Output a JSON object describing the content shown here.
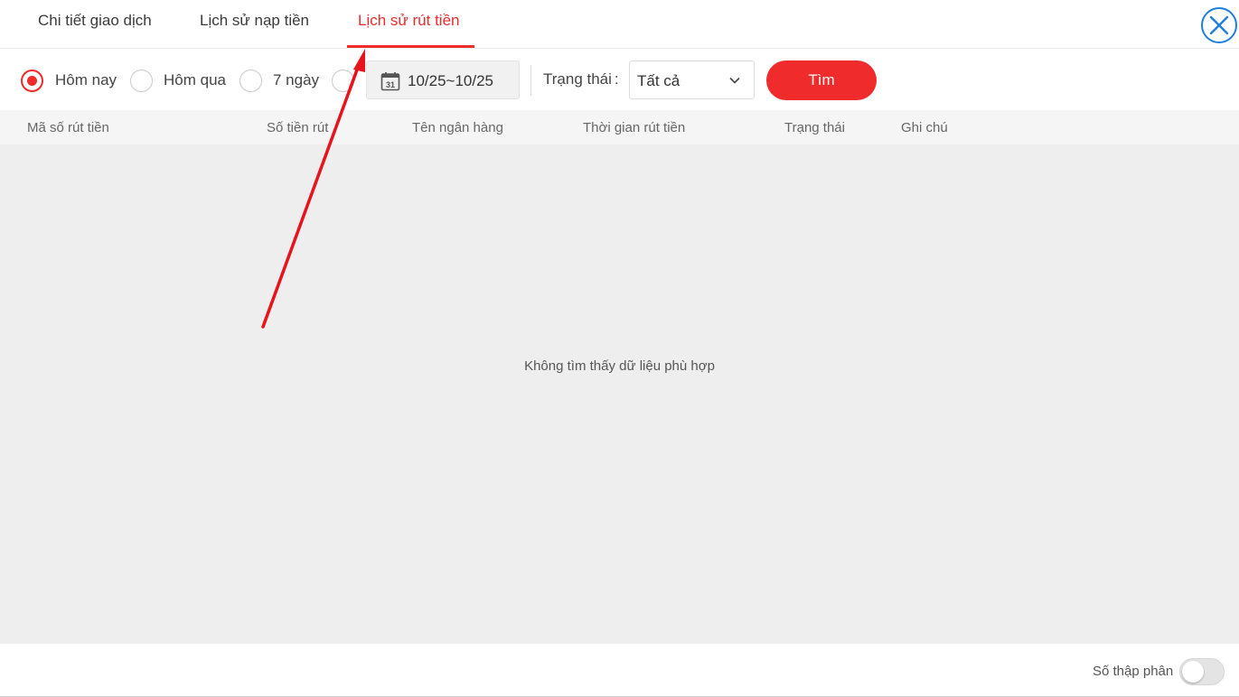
{
  "tabs": {
    "items": [
      {
        "label": "Chi tiết giao dịch",
        "active": false
      },
      {
        "label": "Lịch sử nạp tiền",
        "active": false
      },
      {
        "label": "Lịch sử rút tiền",
        "active": true
      }
    ],
    "close_icon": "close-icon"
  },
  "filters": {
    "options": [
      {
        "label": "Hôm nay",
        "selected": true
      },
      {
        "label": "Hôm qua",
        "selected": false
      },
      {
        "label": "7 ngày",
        "selected": false
      },
      {
        "label": "",
        "selected": false
      }
    ],
    "date_range": "10/25~10/25",
    "date_icon_day": "31",
    "status_label": "Trạng thái",
    "status_colon": ":",
    "status_value": "Tất cả",
    "search_label": "Tìm"
  },
  "table": {
    "columns": [
      "Mã số rút tiền",
      "Số tiền rút",
      "Tên ngân hàng",
      "Thời gian rút tiền",
      "Trạng thái",
      "Ghi chú"
    ],
    "rows": [],
    "empty_message": "Không tìm thấy dữ liệu phù hợp"
  },
  "footer": {
    "decimal_label": "Số thập phân",
    "decimal_on": false
  },
  "colors": {
    "accent": "#ef2b2b",
    "close_blue": "#1e7ee0",
    "annotation_arrow": "#e8141b"
  }
}
